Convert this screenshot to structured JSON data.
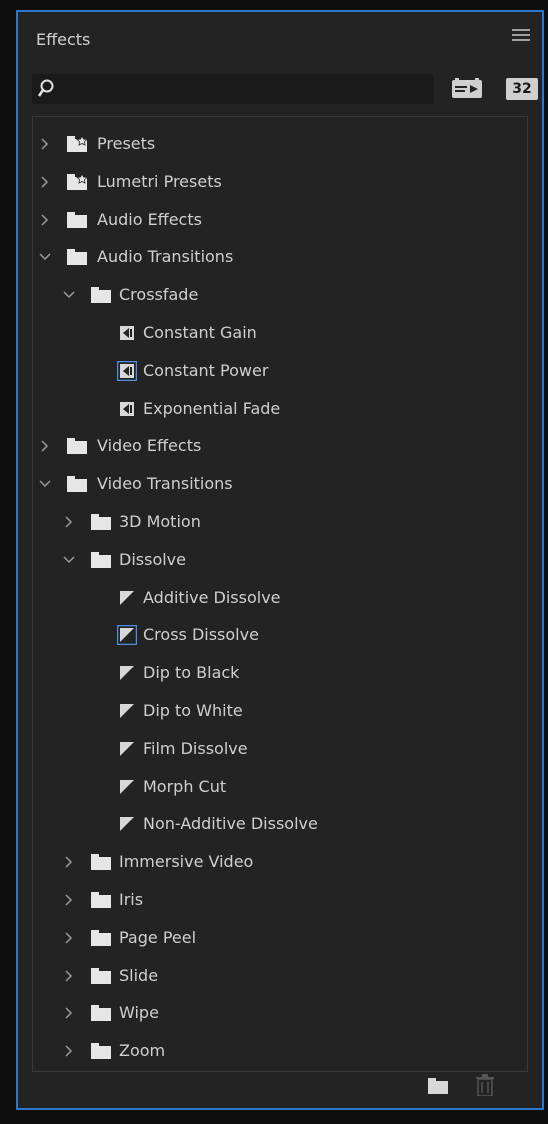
{
  "panel": {
    "title": "Effects",
    "accent": "#2f78c8"
  },
  "search": {
    "value": "",
    "placeholder": ""
  },
  "toolbar": {
    "badge_32": "32"
  },
  "tree": [
    {
      "type": "folder",
      "label": "Presets",
      "level": 0,
      "expanded": false,
      "star": true
    },
    {
      "type": "folder",
      "label": "Lumetri Presets",
      "level": 0,
      "expanded": false,
      "star": true
    },
    {
      "type": "folder",
      "label": "Audio Effects",
      "level": 0,
      "expanded": false
    },
    {
      "type": "folder",
      "label": "Audio Transitions",
      "level": 0,
      "expanded": true
    },
    {
      "type": "folder",
      "label": "Crossfade",
      "level": 1,
      "expanded": true
    },
    {
      "type": "audio",
      "label": "Constant Gain",
      "level": 2
    },
    {
      "type": "audio",
      "label": "Constant Power",
      "level": 2,
      "highlight": true
    },
    {
      "type": "audio",
      "label": "Exponential Fade",
      "level": 2
    },
    {
      "type": "folder",
      "label": "Video Effects",
      "level": 0,
      "expanded": false
    },
    {
      "type": "folder",
      "label": "Video Transitions",
      "level": 0,
      "expanded": true
    },
    {
      "type": "folder",
      "label": "3D Motion",
      "level": 1,
      "expanded": false
    },
    {
      "type": "folder",
      "label": "Dissolve",
      "level": 1,
      "expanded": true
    },
    {
      "type": "video",
      "label": "Additive Dissolve",
      "level": 2
    },
    {
      "type": "video",
      "label": "Cross Dissolve",
      "level": 2,
      "highlight": true
    },
    {
      "type": "video",
      "label": "Dip to Black",
      "level": 2
    },
    {
      "type": "video",
      "label": "Dip to White",
      "level": 2
    },
    {
      "type": "video",
      "label": "Film Dissolve",
      "level": 2
    },
    {
      "type": "video",
      "label": "Morph Cut",
      "level": 2
    },
    {
      "type": "video",
      "label": "Non-Additive Dissolve",
      "level": 2
    },
    {
      "type": "folder",
      "label": "Immersive Video",
      "level": 1,
      "expanded": false
    },
    {
      "type": "folder",
      "label": "Iris",
      "level": 1,
      "expanded": false
    },
    {
      "type": "folder",
      "label": "Page Peel",
      "level": 1,
      "expanded": false
    },
    {
      "type": "folder",
      "label": "Slide",
      "level": 1,
      "expanded": false
    },
    {
      "type": "folder",
      "label": "Wipe",
      "level": 1,
      "expanded": false
    },
    {
      "type": "folder",
      "label": "Zoom",
      "level": 1,
      "expanded": false
    }
  ],
  "icons": {
    "menu": "hamburger-menu-icon",
    "search": "search-icon",
    "accelerated": "accelerated-effects-icon",
    "bit32": "32-bit-color-icon",
    "folder": "folder-icon",
    "audio": "audio-transition-icon",
    "video": "video-transition-icon",
    "new_bin": "new-custom-bin-icon",
    "delete": "trash-icon"
  }
}
